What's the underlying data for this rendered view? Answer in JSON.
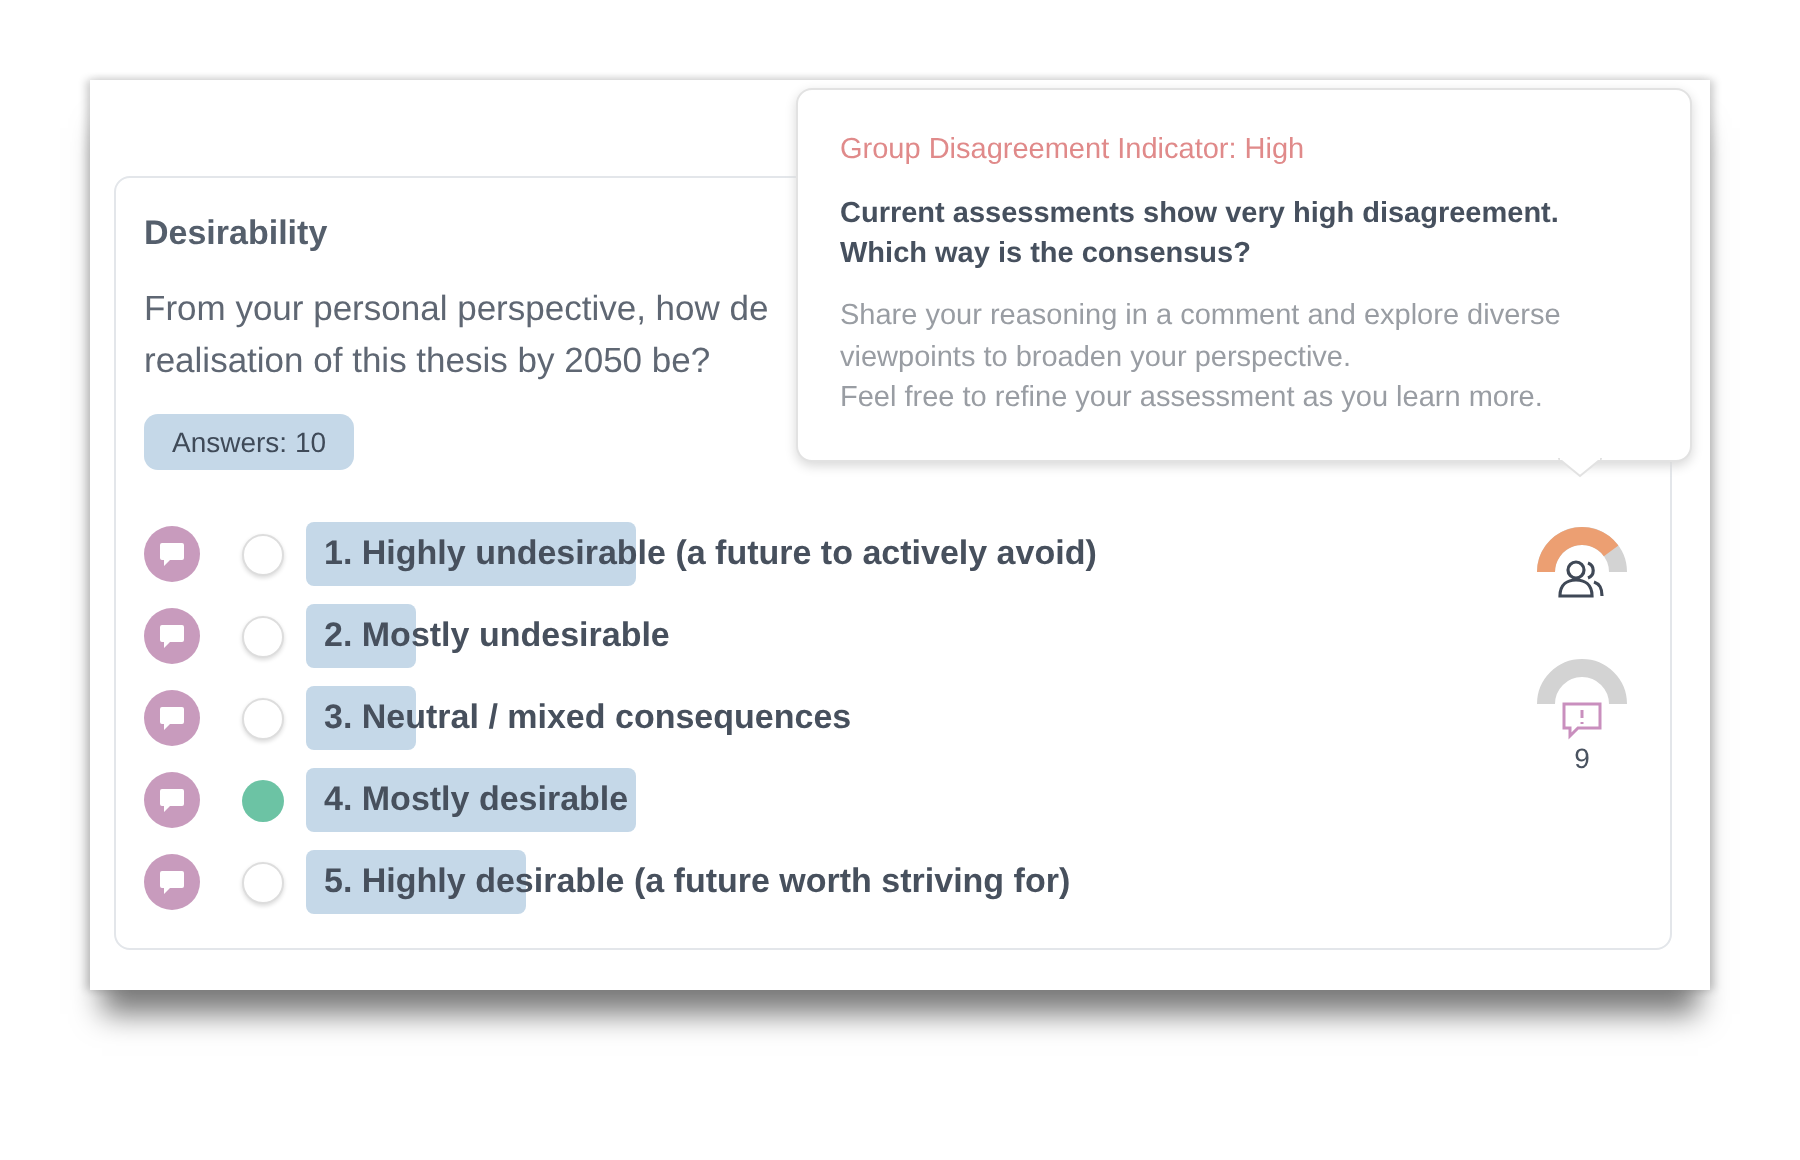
{
  "card": {
    "title": "Desirability",
    "question_lines": [
      "From your personal perspective, how de",
      "realisation of this thesis by 2050 be?"
    ],
    "answers_badge": "Answers: 10"
  },
  "options": [
    {
      "label": "1. Highly undesirable (a future to actively avoid)",
      "selected": false
    },
    {
      "label": "2. Mostly undesirable",
      "selected": false
    },
    {
      "label": "3. Neutral / mixed consequences",
      "selected": false
    },
    {
      "label": "4. Mostly desirable",
      "selected": true
    },
    {
      "label": "5. Highly desirable (a future worth striving for)",
      "selected": false
    }
  ],
  "indicators": [
    {
      "kind": "disagreement"
    },
    {
      "kind": "comments",
      "count": "9"
    }
  ],
  "tooltip": {
    "title": "Group Disagreement Indicator: High",
    "headline": [
      "Current assessments show very high disagreement.",
      "Which way is the consensus?"
    ],
    "body": [
      "Share your reasoning in a comment and explore diverse viewpoints to broaden your perspective.",
      "Feel free to refine your assessment as you learn more."
    ]
  }
}
